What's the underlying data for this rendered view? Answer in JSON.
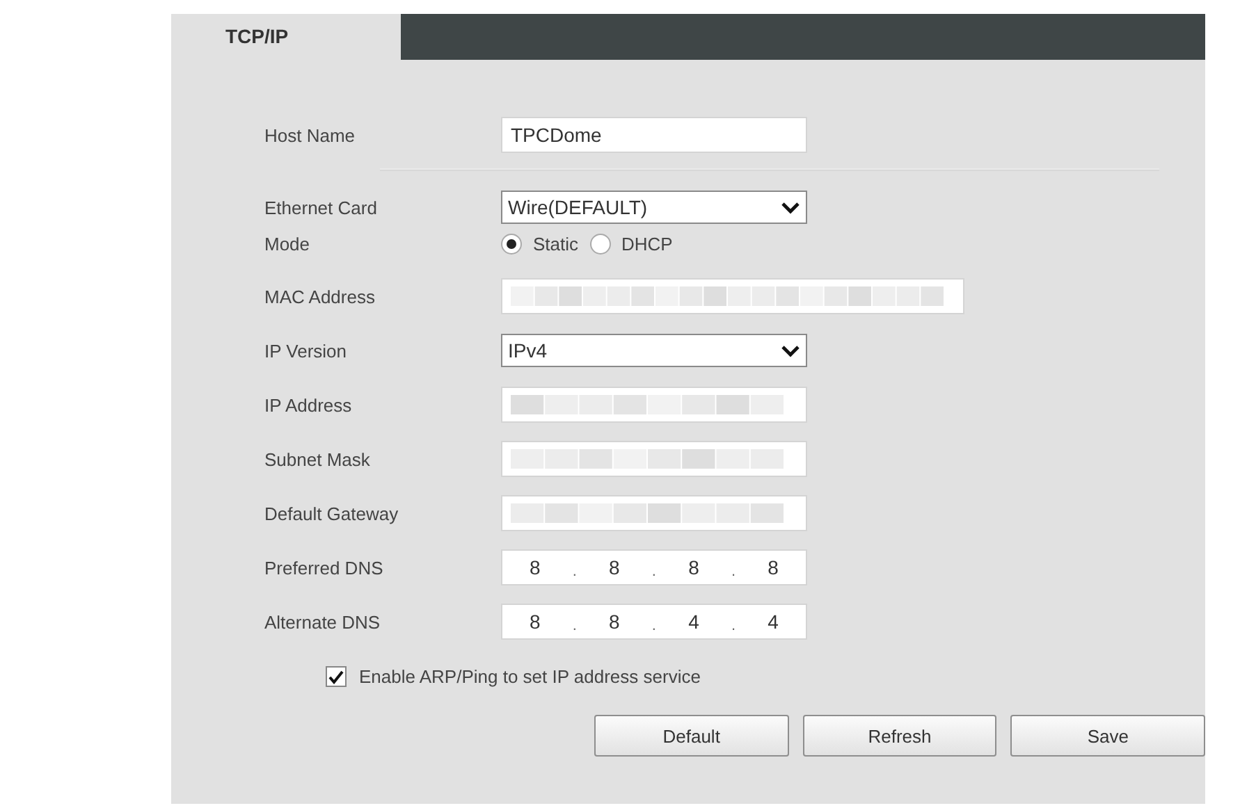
{
  "tabs": [
    {
      "label": "TCP/IP",
      "selected": true
    }
  ],
  "sections": [
    [
      {
        "kind": "text",
        "label": "Host Name",
        "value": "TPCDome"
      }
    ],
    [
      {
        "kind": "select",
        "label": "Ethernet Card",
        "value": "Wire(DEFAULT)"
      },
      {
        "kind": "radio",
        "label": "Mode",
        "options": [
          {
            "label": "Static",
            "selected": true
          },
          {
            "label": "DHCP",
            "selected": false
          }
        ]
      },
      {
        "kind": "blurred",
        "label": "MAC Address",
        "wide": true
      },
      {
        "kind": "select",
        "label": "IP Version",
        "value": "IPv4"
      },
      {
        "kind": "blurred",
        "label": "IP Address",
        "wide": false
      },
      {
        "kind": "blurred",
        "label": "Subnet Mask",
        "wide": false
      },
      {
        "kind": "blurred",
        "label": "Default Gateway",
        "wide": false
      },
      {
        "kind": "ip",
        "label": "Preferred DNS",
        "octets": [
          "8",
          "8",
          "8",
          "8"
        ],
        "dot": "."
      },
      {
        "kind": "ip",
        "label": "Alternate DNS",
        "octets": [
          "8",
          "8",
          "4",
          "4"
        ],
        "dot": "."
      }
    ]
  ],
  "checkbox": {
    "label": "Enable ARP/Ping to set IP address service",
    "checked": true
  },
  "buttons": [
    "Default",
    "Refresh",
    "Save"
  ]
}
